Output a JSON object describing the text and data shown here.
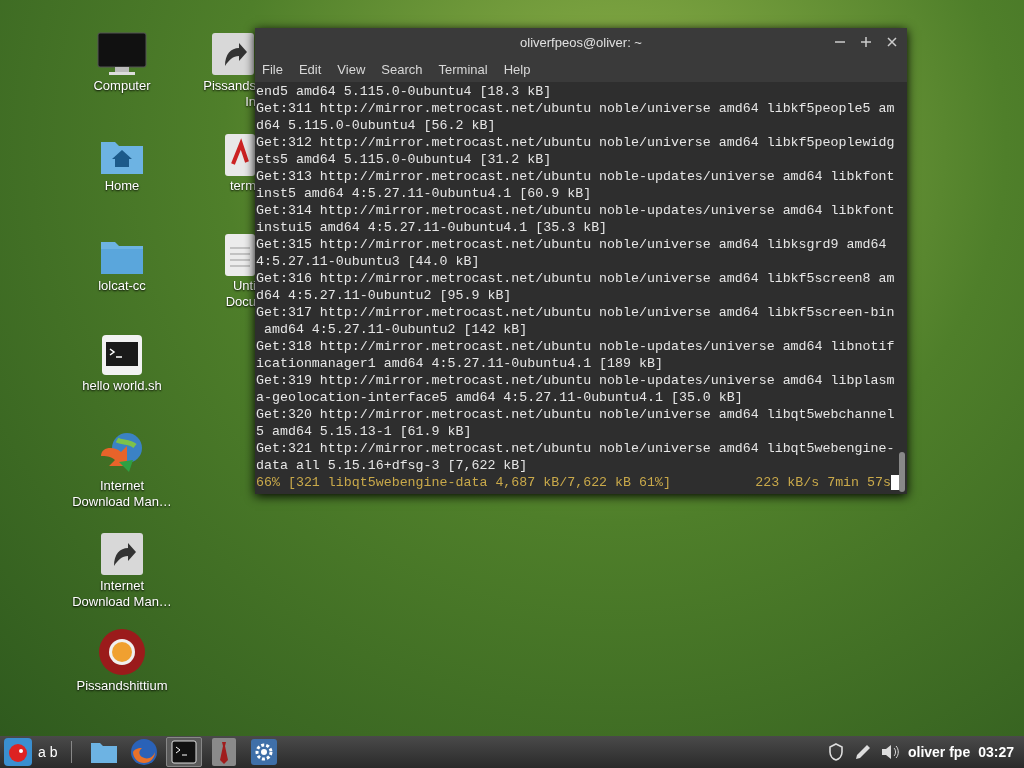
{
  "desktop_icons": [
    {
      "kind": "monitor",
      "label": "Computer"
    },
    {
      "kind": "home",
      "label": "Home"
    },
    {
      "kind": "folder",
      "label": "lolcat-cc"
    },
    {
      "kind": "script",
      "label": "hello world.sh"
    },
    {
      "kind": "globe",
      "label": "Internet Download Man…"
    },
    {
      "kind": "link",
      "label": "Internet Download Man…"
    },
    {
      "kind": "browser",
      "label": "Pissandshittium"
    }
  ],
  "covered_icons": [
    {
      "kind": "link",
      "lines": [
        "Pissands",
        "In"
      ]
    },
    {
      "kind": "pdf",
      "lines": [
        "term"
      ]
    },
    {
      "kind": "doc",
      "lines": [
        "Unti",
        "Docu"
      ]
    }
  ],
  "terminal": {
    "title": "oliverfpeos@oliver: ~",
    "menu": [
      "File",
      "Edit",
      "View",
      "Search",
      "Terminal",
      "Help"
    ],
    "lines": [
      "end5 amd64 5.115.0-0ubuntu4 [18.3 kB]",
      "Get:311 http://mirror.metrocast.net/ubuntu noble/universe amd64 libkf5people5 am",
      "d64 5.115.0-0ubuntu4 [56.2 kB]",
      "Get:312 http://mirror.metrocast.net/ubuntu noble/universe amd64 libkf5peoplewidg",
      "ets5 amd64 5.115.0-0ubuntu4 [31.2 kB]",
      "Get:313 http://mirror.metrocast.net/ubuntu noble-updates/universe amd64 libkfont",
      "inst5 amd64 4:5.27.11-0ubuntu4.1 [60.9 kB]",
      "Get:314 http://mirror.metrocast.net/ubuntu noble-updates/universe amd64 libkfont",
      "instui5 amd64 4:5.27.11-0ubuntu4.1 [35.3 kB]",
      "Get:315 http://mirror.metrocast.net/ubuntu noble/universe amd64 libksgrd9 amd64",
      "4:5.27.11-0ubuntu3 [44.0 kB]",
      "Get:316 http://mirror.metrocast.net/ubuntu noble/universe amd64 libkf5screen8 am",
      "d64 4:5.27.11-0ubuntu2 [95.9 kB]",
      "Get:317 http://mirror.metrocast.net/ubuntu noble/universe amd64 libkf5screen-bin",
      " amd64 4:5.27.11-0ubuntu2 [142 kB]",
      "Get:318 http://mirror.metrocast.net/ubuntu noble-updates/universe amd64 libnotif",
      "icationmanager1 amd64 4:5.27.11-0ubuntu4.1 [189 kB]",
      "Get:319 http://mirror.metrocast.net/ubuntu noble-updates/universe amd64 libplasm",
      "a-geolocation-interface5 amd64 4:5.27.11-0ubuntu4.1 [35.0 kB]",
      "Get:320 http://mirror.metrocast.net/ubuntu noble/universe amd64 libqt5webchannel",
      "5 amd64 5.15.13-1 [61.9 kB]",
      "Get:321 http://mirror.metrocast.net/ubuntu noble/universe amd64 libqt5webengine-",
      "data all 5.15.16+dfsg-3 [7,622 kB]"
    ],
    "progress_left": "66% [321 libqt5webengine-data 4,687 kB/7,622 kB 61%]",
    "progress_right": "223 kB/s 7min 57s"
  },
  "taskbar": {
    "start_label": "a b",
    "apps": [
      {
        "kind": "folder",
        "selected": false
      },
      {
        "kind": "firefox",
        "selected": false
      },
      {
        "kind": "terminal",
        "selected": true
      },
      {
        "kind": "tie",
        "selected": false
      },
      {
        "kind": "gear",
        "selected": false
      }
    ],
    "user": "oliver fpe",
    "clock": "03:27"
  }
}
